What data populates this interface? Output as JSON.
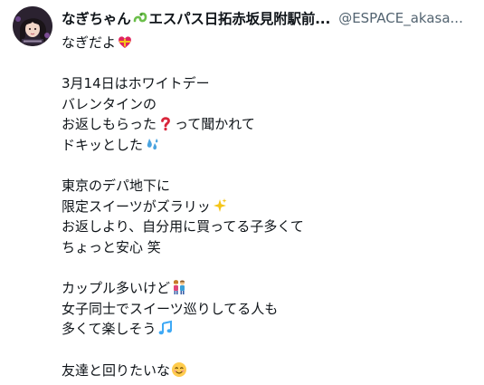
{
  "tweet": {
    "display_name": "なぎちゃん",
    "display_name_suffix": "エスパス日拓赤坂見附駅前...",
    "handle": "@ESPACE_akasa...",
    "name_emoji": "snake-icon",
    "lines": [
      {
        "text": "なぎだよ",
        "emoji": "heart-ribbon-icon"
      },
      {
        "text": ""
      },
      {
        "text": "3月14日はホワイトデー"
      },
      {
        "text": "バレンタインの"
      },
      {
        "text": "お返しもらった",
        "emoji": "question-mark-icon",
        "text_after": "って聞かれて"
      },
      {
        "text": "ドキッとした",
        "emoji": "sweat-droplets-icon"
      },
      {
        "text": ""
      },
      {
        "text": "東京のデパ地下に"
      },
      {
        "text": "限定スイーツがズラリッ",
        "emoji": "sparkles-icon"
      },
      {
        "text": "お返しより、自分用に買ってる子多くて"
      },
      {
        "text": "ちょっと安心 笑"
      },
      {
        "text": ""
      },
      {
        "text": "カップル多いけど",
        "emoji": "couple-icon"
      },
      {
        "text": "女子同士でスイーツ巡りしてる人も"
      },
      {
        "text": "多くて楽しそう",
        "emoji": "music-notes-icon"
      },
      {
        "text": ""
      },
      {
        "text": "友達と回りたいな",
        "emoji": "smiling-face-icon"
      }
    ]
  },
  "colors": {
    "text": "#0f1419",
    "handle": "#536471",
    "snake": "#6bbf4a",
    "heart": "#e0245e",
    "question": "#d9263b",
    "droplets": "#4aa3df",
    "sparkles": "#f5c518",
    "music": "#3fa9f5"
  }
}
